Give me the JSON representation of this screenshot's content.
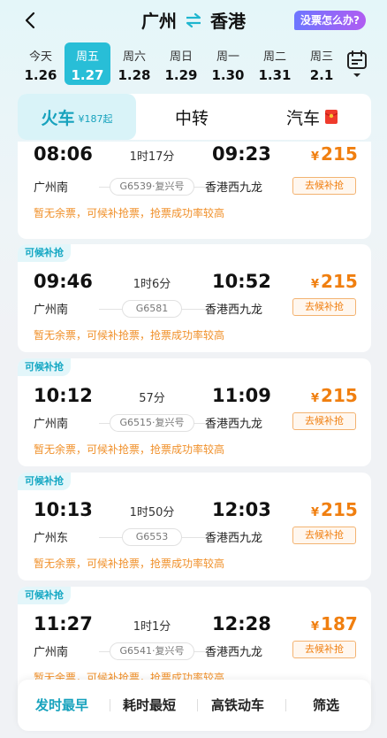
{
  "header": {
    "from": "广州",
    "to": "香港",
    "help": "没票怎么办?"
  },
  "dates": [
    {
      "weekday": "今天",
      "date": "1.26",
      "active": false
    },
    {
      "weekday": "周五",
      "date": "1.27",
      "active": true
    },
    {
      "weekday": "周六",
      "date": "1.28",
      "active": false
    },
    {
      "weekday": "周日",
      "date": "1.29",
      "active": false
    },
    {
      "weekday": "周一",
      "date": "1.30",
      "active": false
    },
    {
      "weekday": "周二",
      "date": "1.31",
      "active": false
    },
    {
      "weekday": "周三",
      "date": "2.1",
      "active": false
    }
  ],
  "modes": {
    "train": "火车",
    "train_sub": "¥187起",
    "transfer": "中转",
    "bus": "汽车"
  },
  "trains": [
    {
      "badge": "",
      "dep": "08:06",
      "arr": "09:23",
      "duration": "1时17分",
      "from": "广州南",
      "to": "香港西九龙",
      "number": "G6539·复兴号",
      "price": "215",
      "button": "去候补抢",
      "note": "暂无余票，可候补抢票，抢票成功率较高"
    },
    {
      "badge": "可候补抢",
      "dep": "09:46",
      "arr": "10:52",
      "duration": "1时6分",
      "from": "广州南",
      "to": "香港西九龙",
      "number": "G6581",
      "price": "215",
      "button": "去候补抢",
      "note": "暂无余票，可候补抢票，抢票成功率较高"
    },
    {
      "badge": "可候补抢",
      "dep": "10:12",
      "arr": "11:09",
      "duration": "57分",
      "from": "广州南",
      "to": "香港西九龙",
      "number": "G6515·复兴号",
      "price": "215",
      "button": "去候补抢",
      "note": "暂无余票，可候补抢票，抢票成功率较高"
    },
    {
      "badge": "可候补抢",
      "dep": "10:13",
      "arr": "12:03",
      "duration": "1时50分",
      "from": "广州东",
      "to": "香港西九龙",
      "number": "G6553",
      "price": "215",
      "button": "去候补抢",
      "note": "暂无余票，可候补抢票，抢票成功率较高"
    },
    {
      "badge": "可候补抢",
      "dep": "11:27",
      "arr": "12:28",
      "duration": "1时1分",
      "from": "广州南",
      "to": "香港西九龙",
      "number": "G6541·复兴号",
      "price": "187",
      "button": "去候补抢",
      "note": "暂无余票，可候补抢票，抢票成功率较高"
    }
  ],
  "currency": "¥",
  "sort": {
    "earliest": "发时最早",
    "shortest": "耗时最短",
    "hsr": "高铁动车",
    "filter": "筛选"
  },
  "colors": {
    "accent": "#17a2bd",
    "price": "#f07f10"
  }
}
